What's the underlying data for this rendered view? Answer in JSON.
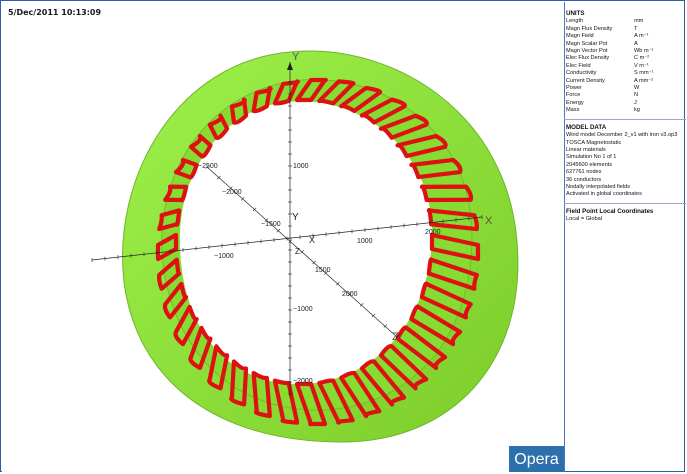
{
  "timestamp": "5/Dec/2011 10:13:09",
  "opera_label": "Opera",
  "axes": {
    "y_label": "Y",
    "x_label": "X",
    "z_label": "Z",
    "y_ticks": [
      "1000",
      "−1000",
      "−2000"
    ],
    "x_ticks": [
      "−1000",
      "1000",
      "2000"
    ],
    "z_ticks": [
      "1500",
      "2000",
      "−2500",
      "−2000",
      "−1500"
    ]
  },
  "units": {
    "title": "UNITS",
    "rows": [
      {
        "q": "Length",
        "u": "mm"
      },
      {
        "q": "Magn Flux Density",
        "u": "T"
      },
      {
        "q": "Magn Field",
        "u": "A m⁻¹"
      },
      {
        "q": "Magn Scalar Pot",
        "u": "A"
      },
      {
        "q": "Magn Vector Pot",
        "u": "Wb m⁻¹"
      },
      {
        "q": "Elec Flux Density",
        "u": "C m⁻²"
      },
      {
        "q": "Elec Field",
        "u": "V m⁻¹"
      },
      {
        "q": "Conductivity",
        "u": "S mm⁻¹"
      },
      {
        "q": "Current Density",
        "u": "A mm⁻²"
      },
      {
        "q": "Power",
        "u": "W"
      },
      {
        "q": "Force",
        "u": "N"
      },
      {
        "q": "Energy",
        "u": "J"
      },
      {
        "q": "Mass",
        "u": "kg"
      }
    ]
  },
  "model": {
    "title": "MODEL DATA",
    "lines": [
      "Wind model December 2_v1 with iron v3.op3",
      "TOSCA Magnetostatic",
      "Linear materials",
      "Simulation No 1 of 1",
      "2045600 elements",
      "627761 nodes",
      "36 conductors",
      "Nodally interpolated fields",
      "Activated in global coordinates"
    ]
  },
  "fieldpoint": {
    "title": "Field Point Local Coordinates",
    "line": "Local = Global"
  },
  "colors": {
    "iron": "#8fe03a",
    "coil": "#dd1111",
    "accent": "#2e6fae"
  }
}
